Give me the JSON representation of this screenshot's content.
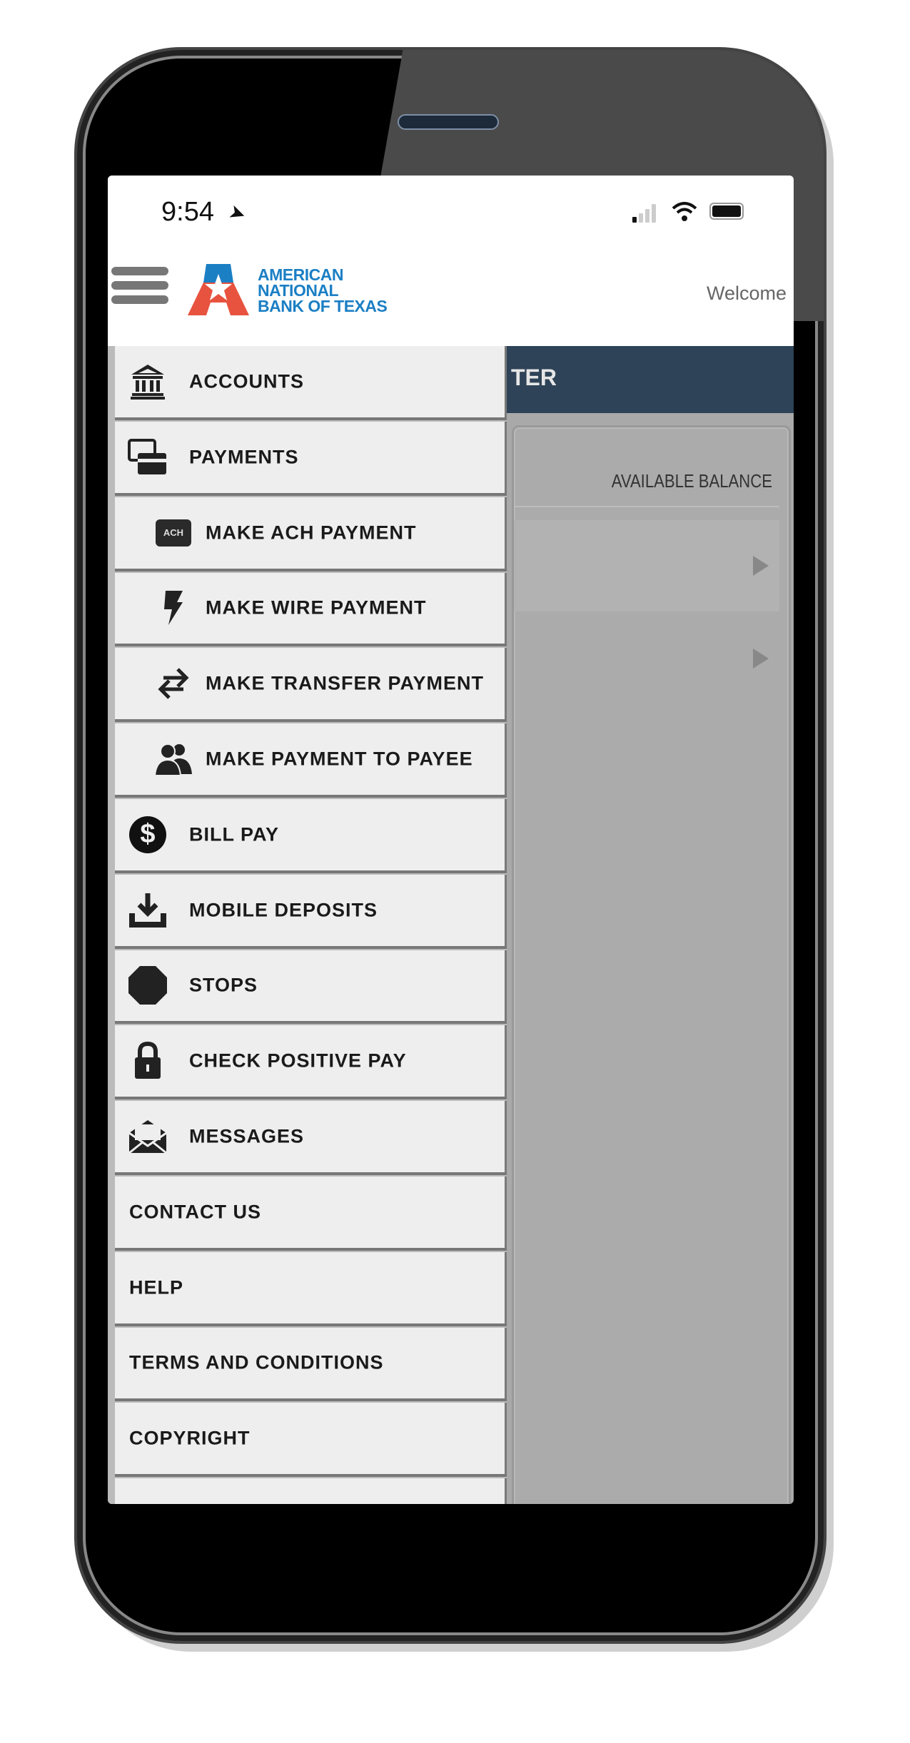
{
  "status_bar": {
    "time": "9:54"
  },
  "header": {
    "logo_lines": [
      "AMERICAN",
      "NATIONAL",
      "BANK OF TEXAS"
    ],
    "welcome": "Welcome"
  },
  "background_page": {
    "title_fragment": "TER",
    "column_header": "AVAILABLE BALANCE"
  },
  "colors": {
    "navy": "#2e4357",
    "logo_blue": "#1b7fc4",
    "logo_red": "#e8533f"
  },
  "menu": {
    "items": [
      {
        "label": "ACCOUNTS",
        "icon": "bank-icon",
        "level": 1
      },
      {
        "label": "PAYMENTS",
        "icon": "payments-icon",
        "level": 1
      },
      {
        "label": "MAKE ACH PAYMENT",
        "icon": "ach-icon",
        "icon_text": "ACH",
        "level": 2
      },
      {
        "label": "MAKE WIRE PAYMENT",
        "icon": "lightning-icon",
        "level": 2
      },
      {
        "label": "MAKE TRANSFER PAYMENT",
        "icon": "transfer-arrows-icon",
        "level": 2
      },
      {
        "label": "MAKE PAYMENT TO PAYEE",
        "icon": "people-icon",
        "level": 2
      },
      {
        "label": "BILL PAY",
        "icon": "dollar-circle-icon",
        "level": 1
      },
      {
        "label": "MOBILE DEPOSITS",
        "icon": "download-tray-icon",
        "level": 1
      },
      {
        "label": "STOPS",
        "icon": "octagon-icon",
        "level": 1
      },
      {
        "label": "CHECK POSITIVE PAY",
        "icon": "lock-icon",
        "level": 1
      },
      {
        "label": "MESSAGES",
        "icon": "envelope-icon",
        "level": 1
      },
      {
        "label": "CONTACT US",
        "level": 0
      },
      {
        "label": "HELP",
        "level": 0
      },
      {
        "label": "TERMS AND CONDITIONS",
        "level": 0
      },
      {
        "label": "COPYRIGHT",
        "level": 0
      },
      {
        "label": "",
        "level": 0
      }
    ]
  }
}
